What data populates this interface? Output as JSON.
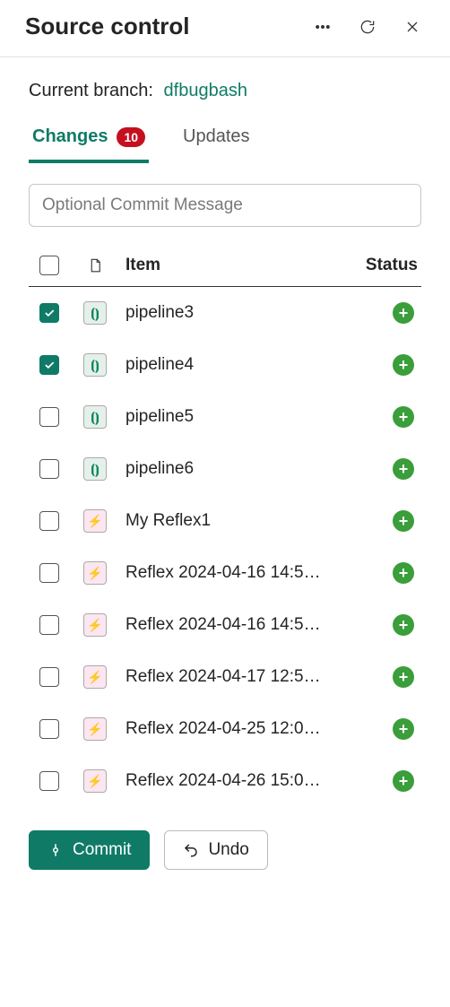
{
  "header": {
    "title": "Source control"
  },
  "branch": {
    "label": "Current branch:",
    "name": "dfbugbash"
  },
  "tabs": {
    "changes_label": "Changes",
    "changes_count": "10",
    "updates_label": "Updates"
  },
  "commit_msg": {
    "placeholder": "Optional Commit Message",
    "value": ""
  },
  "columns": {
    "item": "Item",
    "status": "Status"
  },
  "items": [
    {
      "name": "pipeline3",
      "type": "pipeline",
      "checked": true,
      "status": "added"
    },
    {
      "name": "pipeline4",
      "type": "pipeline",
      "checked": true,
      "status": "added"
    },
    {
      "name": "pipeline5",
      "type": "pipeline",
      "checked": false,
      "status": "added"
    },
    {
      "name": "pipeline6",
      "type": "pipeline",
      "checked": false,
      "status": "added"
    },
    {
      "name": "My Reflex1",
      "type": "reflex",
      "checked": false,
      "status": "added"
    },
    {
      "name": "Reflex 2024-04-16 14:5…",
      "type": "reflex",
      "checked": false,
      "status": "added"
    },
    {
      "name": "Reflex 2024-04-16 14:5…",
      "type": "reflex",
      "checked": false,
      "status": "added"
    },
    {
      "name": "Reflex 2024-04-17 12:5…",
      "type": "reflex",
      "checked": false,
      "status": "added"
    },
    {
      "name": "Reflex 2024-04-25 12:0…",
      "type": "reflex",
      "checked": false,
      "status": "added"
    },
    {
      "name": "Reflex 2024-04-26 15:0…",
      "type": "reflex",
      "checked": false,
      "status": "added"
    }
  ],
  "actions": {
    "commit": "Commit",
    "undo": "Undo"
  },
  "icons": {
    "pipeline_glyph": "⦗⦘",
    "reflex_glyph": "⚡",
    "status_added_glyph": "+"
  }
}
